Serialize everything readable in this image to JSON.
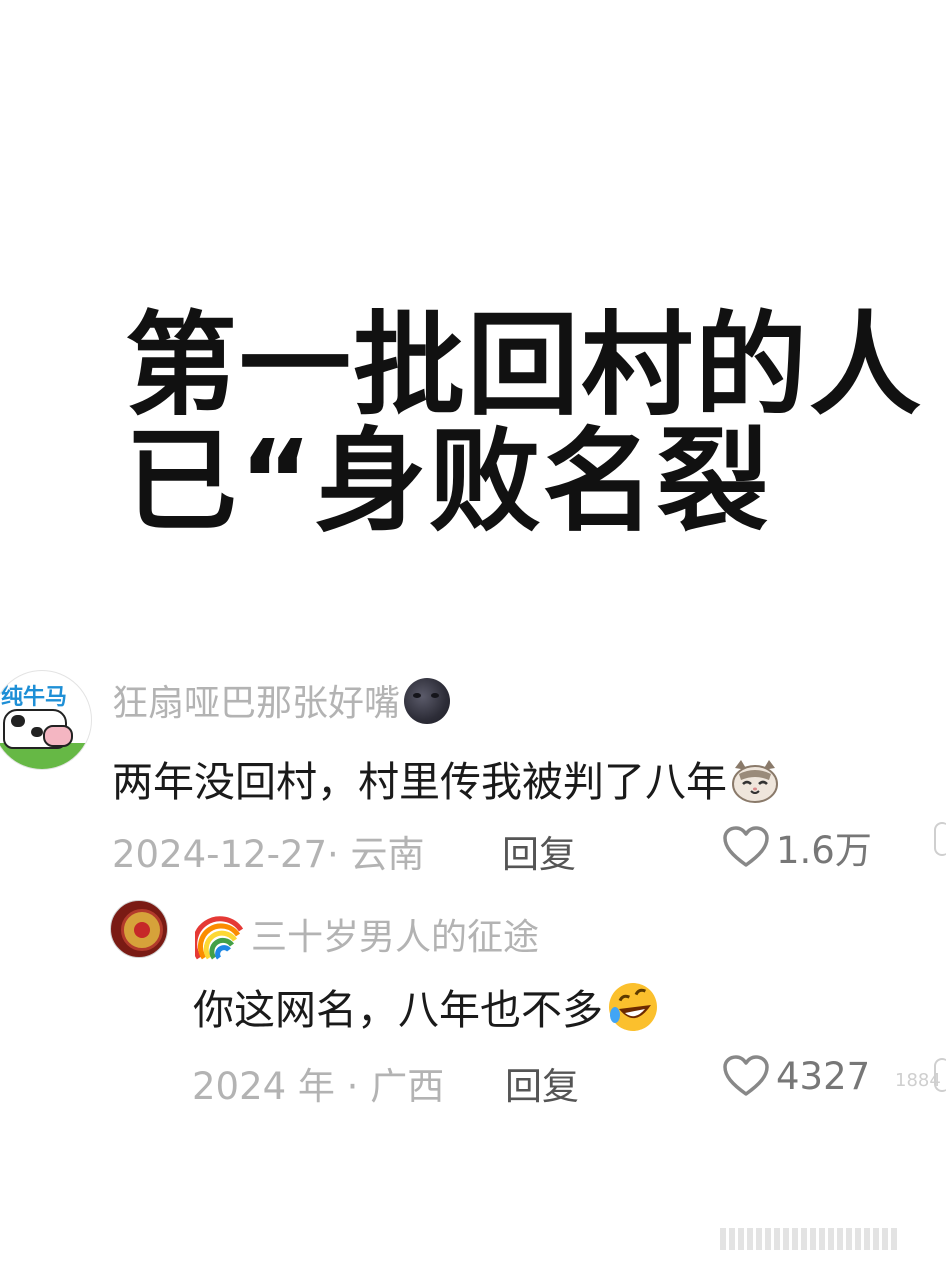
{
  "headline": {
    "line1": "第一批回村的人",
    "line2": "已“身败名裂"
  },
  "comments": [
    {
      "username": "狂扇哑巴那张好嘴",
      "username_icon": "new-moon-face-icon",
      "avatar_text": "纯牛马",
      "text": "两年没回村，村里传我被判了八年",
      "emoji": "cat-face-icon",
      "meta": "2024-12-27· 云南",
      "reply_label": "回复",
      "likes": "1.6万"
    },
    {
      "username": "三十岁男人的征途",
      "username_icon": "rainbow-icon",
      "text": "你这网名，八年也不多",
      "emoji": "rolling-laughing-face-icon",
      "meta": "2024 年 · 广西",
      "reply_label": "回复",
      "likes": "4327"
    }
  ],
  "watermark": "1884",
  "colors": {
    "headline": "#111111",
    "username": "#b3b3b3",
    "body": "#1a1a1a",
    "meta": "#b3b3b3",
    "reply": "#555555"
  }
}
